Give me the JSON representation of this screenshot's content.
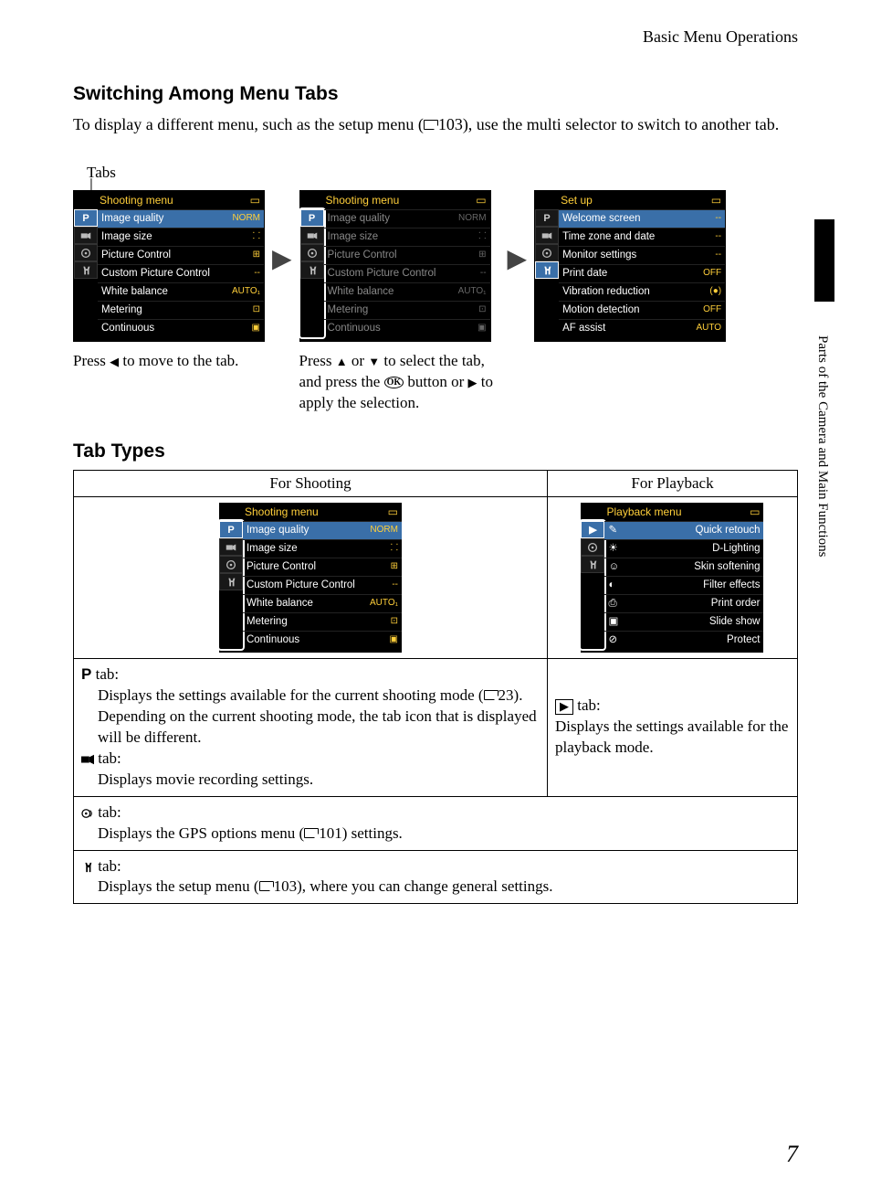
{
  "header": {
    "section": "Basic Menu Operations"
  },
  "sidebar": {
    "chapter": "Parts of the Camera and Main Functions"
  },
  "page_number": "7",
  "h1": "Switching Among Menu Tabs",
  "intro": {
    "part1": "To display a different menu, such as the setup menu (",
    "ref1": "103), use the multi selector to switch to another tab."
  },
  "tabs_label": "Tabs",
  "screens": {
    "shooting_title": "Shooting menu",
    "setup_title": "Set up",
    "items_shooting": [
      {
        "label": "Image quality",
        "val": "NORM"
      },
      {
        "label": "Image size",
        "val": "⸬"
      },
      {
        "label": "Picture Control",
        "val": "⊞"
      },
      {
        "label": "Custom Picture Control",
        "val": "--"
      },
      {
        "label": "White balance",
        "val": "AUTO₁"
      },
      {
        "label": "Metering",
        "val": "⊡"
      },
      {
        "label": "Continuous",
        "val": "▣"
      }
    ],
    "items_setup": [
      {
        "label": "Welcome screen",
        "val": "--"
      },
      {
        "label": "Time zone and date",
        "val": "--"
      },
      {
        "label": "Monitor settings",
        "val": "--"
      },
      {
        "label": "Print date",
        "val": "OFF"
      },
      {
        "label": "Vibration reduction",
        "val": "(●)"
      },
      {
        "label": "Motion detection",
        "val": "OFF"
      },
      {
        "label": "AF assist",
        "val": "AUTO"
      }
    ],
    "cap1_a": "Press ",
    "cap1_b": " to move to the tab.",
    "cap2_a": "Press ",
    "cap2_b": " or ",
    "cap2_c": " to select the tab, and press the ",
    "cap2_d": " button or ",
    "cap2_e": " to apply the selection."
  },
  "h2": "Tab Types",
  "table": {
    "head_shoot": "For Shooting",
    "head_play": "For Playback",
    "playback_title": "Playback menu",
    "playback_items": [
      "Quick retouch",
      "D-Lighting",
      "Skin softening",
      "Filter effects",
      "Print order",
      "Slide show",
      "Protect"
    ],
    "desc_p_label": " tab:",
    "desc_p_1": "Displays the settings available for the current shooting mode (",
    "desc_p_ref": "23).",
    "desc_p_2": "Depending on the current shooting mode, the tab icon that is displayed will be different.",
    "desc_movie": " tab:",
    "desc_movie_text": "Displays movie recording settings.",
    "desc_play_label": " tab:",
    "desc_play_text": "Displays the settings available for the playback mode.",
    "desc_gps": " tab:",
    "desc_gps_text_a": "Displays the GPS options menu (",
    "desc_gps_ref": "101) settings.",
    "desc_setup": " tab:",
    "desc_setup_text_a": "Displays the setup menu (",
    "desc_setup_ref": "103), where you can change general settings."
  }
}
